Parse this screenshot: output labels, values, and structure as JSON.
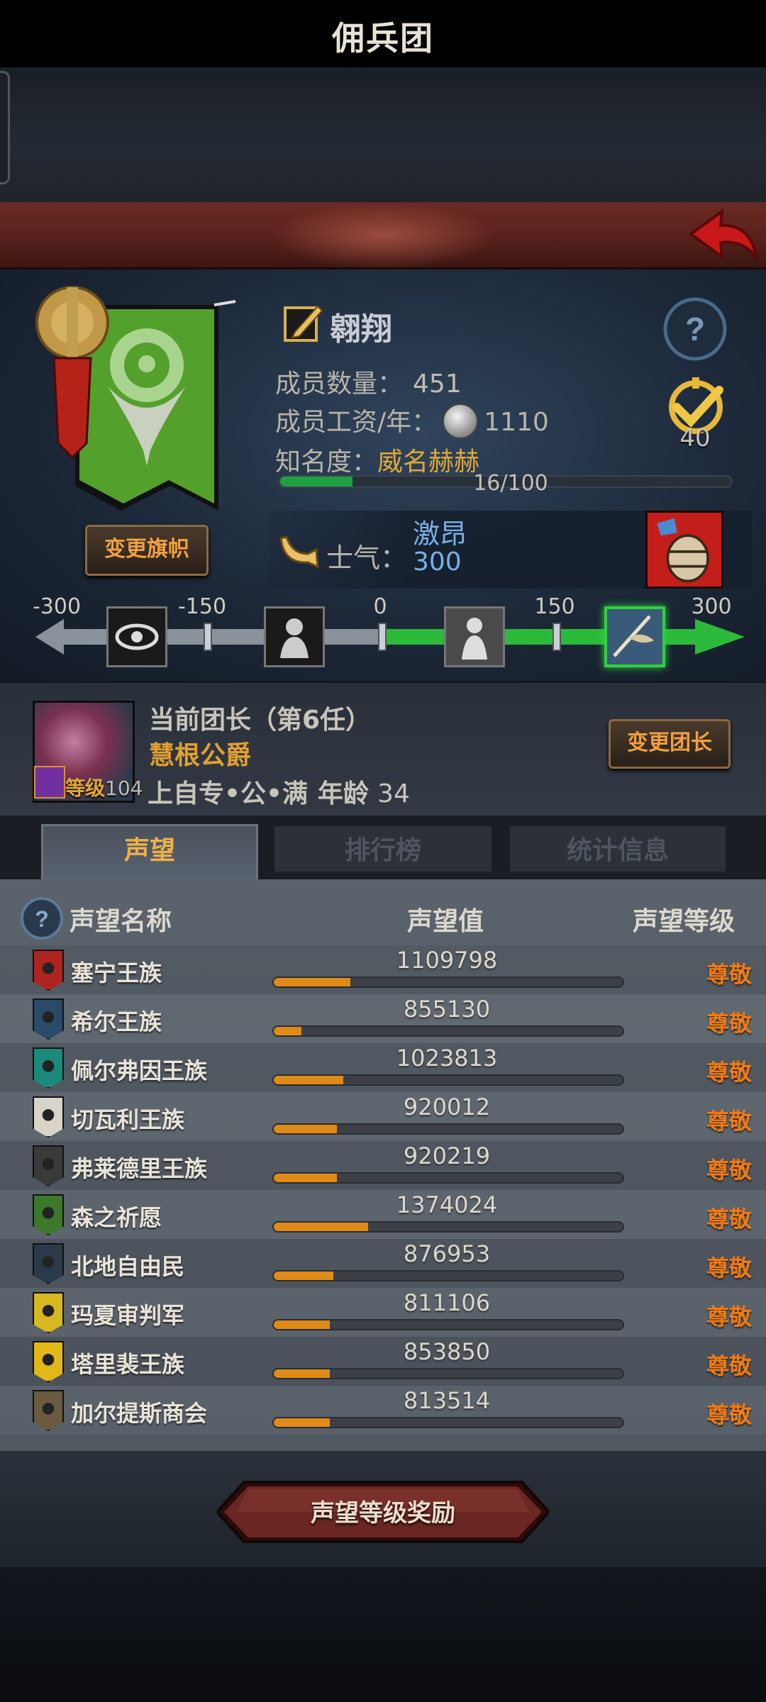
{
  "header": {
    "title": "佣兵团"
  },
  "company": {
    "name": "翱翔",
    "change_banner_label": "变更旗帜",
    "members_label": "成员数量：",
    "members": "451",
    "wage_label": "成员工资/年：",
    "wage": "1110",
    "fame_label": "知名度：",
    "fame_title": "威名赫赫",
    "fame_progress_text": "16/100",
    "fame_progress": 0.16,
    "rank": "40"
  },
  "morale": {
    "label": "士气：",
    "state": "激昂",
    "value": "300",
    "scale_ticks": [
      "-300",
      "-150",
      "0",
      "150",
      "300"
    ],
    "value_numeric": 300
  },
  "leader": {
    "title": "当前团长（第6任）",
    "name": "慧根公爵",
    "level_label": "等级",
    "level": "104",
    "traits": "上自专•公•满",
    "age_label": "年龄",
    "age": "34",
    "change_label": "变更团长"
  },
  "tabs": [
    {
      "label": "声望",
      "active": true
    },
    {
      "label": "排行榜",
      "active": false
    },
    {
      "label": "统计信息",
      "active": false
    }
  ],
  "reputation": {
    "headers": {
      "name": "声望名称",
      "value": "声望值",
      "level": "声望等级"
    },
    "rows": [
      {
        "name": "塞宁王族",
        "value": "1109798",
        "level": "尊敬",
        "progress": 0.22,
        "color": "#b02420"
      },
      {
        "name": "希尔王族",
        "value": "855130",
        "level": "尊敬",
        "progress": 0.08,
        "color": "#2a4a6a"
      },
      {
        "name": "佩尔弗因王族",
        "value": "1023813",
        "level": "尊敬",
        "progress": 0.2,
        "color": "#1a8a7a"
      },
      {
        "name": "切瓦利王族",
        "value": "920012",
        "level": "尊敬",
        "progress": 0.18,
        "color": "#d8d4c8"
      },
      {
        "name": "弗莱德里王族",
        "value": "920219",
        "level": "尊敬",
        "progress": 0.18,
        "color": "#3a3a3a"
      },
      {
        "name": "森之祈愿",
        "value": "1374024",
        "level": "尊敬",
        "progress": 0.27,
        "color": "#3a7a2a"
      },
      {
        "name": "北地自由民",
        "value": "876953",
        "level": "尊敬",
        "progress": 0.17,
        "color": "#2a3a4a"
      },
      {
        "name": "玛夏审判军",
        "value": "811106",
        "level": "尊敬",
        "progress": 0.16,
        "color": "#d8b820"
      },
      {
        "name": "塔里裴王族",
        "value": "853850",
        "level": "尊敬",
        "progress": 0.16,
        "color": "#e0b818"
      },
      {
        "name": "加尔提斯商会",
        "value": "813514",
        "level": "尊敬",
        "progress": 0.16,
        "color": "#6a5a40"
      }
    ]
  },
  "footer": {
    "reward_label": "声望等级奖励"
  },
  "colors": {
    "accent": "#f0a040",
    "rep_level": "#f07a14",
    "morale": "#7ab0e8",
    "fame_fill": "#20a040"
  }
}
